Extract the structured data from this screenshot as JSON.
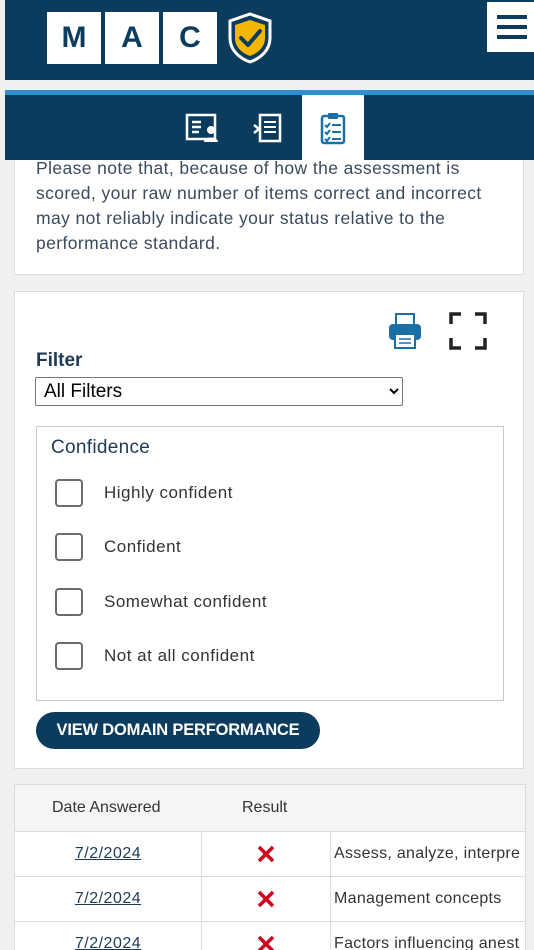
{
  "header": {
    "logo_letters": [
      "M",
      "A",
      "C"
    ],
    "brand_color": "#0b3c5d",
    "accent_color": "#2e8fd1",
    "icons": [
      "shield-check-icon",
      "hamburger-menu-icon"
    ]
  },
  "tabs": [
    {
      "icon": "profile-card-icon",
      "active": false
    },
    {
      "icon": "document-list-icon",
      "active": false
    },
    {
      "icon": "clipboard-checklist-icon",
      "active": true
    }
  ],
  "note": {
    "text": "Please note that, because of how the assessment is scored, your raw number of items correct and incorrect may not reliably indicate your status relative to the performance standard."
  },
  "filter": {
    "label": "Filter",
    "selected": "All Filters",
    "toolbar_icons": [
      "print-icon",
      "fullscreen-icon"
    ]
  },
  "confidence": {
    "title": "Confidence",
    "options": [
      {
        "label": "Highly confident",
        "checked": false
      },
      {
        "label": "Confident",
        "checked": false
      },
      {
        "label": "Somewhat confident",
        "checked": false
      },
      {
        "label": "Not at all confident",
        "checked": false
      }
    ]
  },
  "view_domain_button": "VIEW DOMAIN PERFORMANCE",
  "table": {
    "headers": [
      "Date Answered",
      "Result"
    ],
    "rows": [
      {
        "date": "7/2/2024",
        "result_icon": "incorrect-x-icon",
        "description": "Assess, analyze, interpre"
      },
      {
        "date": "7/2/2024",
        "result_icon": "incorrect-x-icon",
        "description": "Management concepts"
      },
      {
        "date": "7/2/2024",
        "result_icon": "incorrect-x-icon",
        "description": "Factors influencing anest"
      }
    ],
    "incorrect_color": "#d0021b"
  }
}
